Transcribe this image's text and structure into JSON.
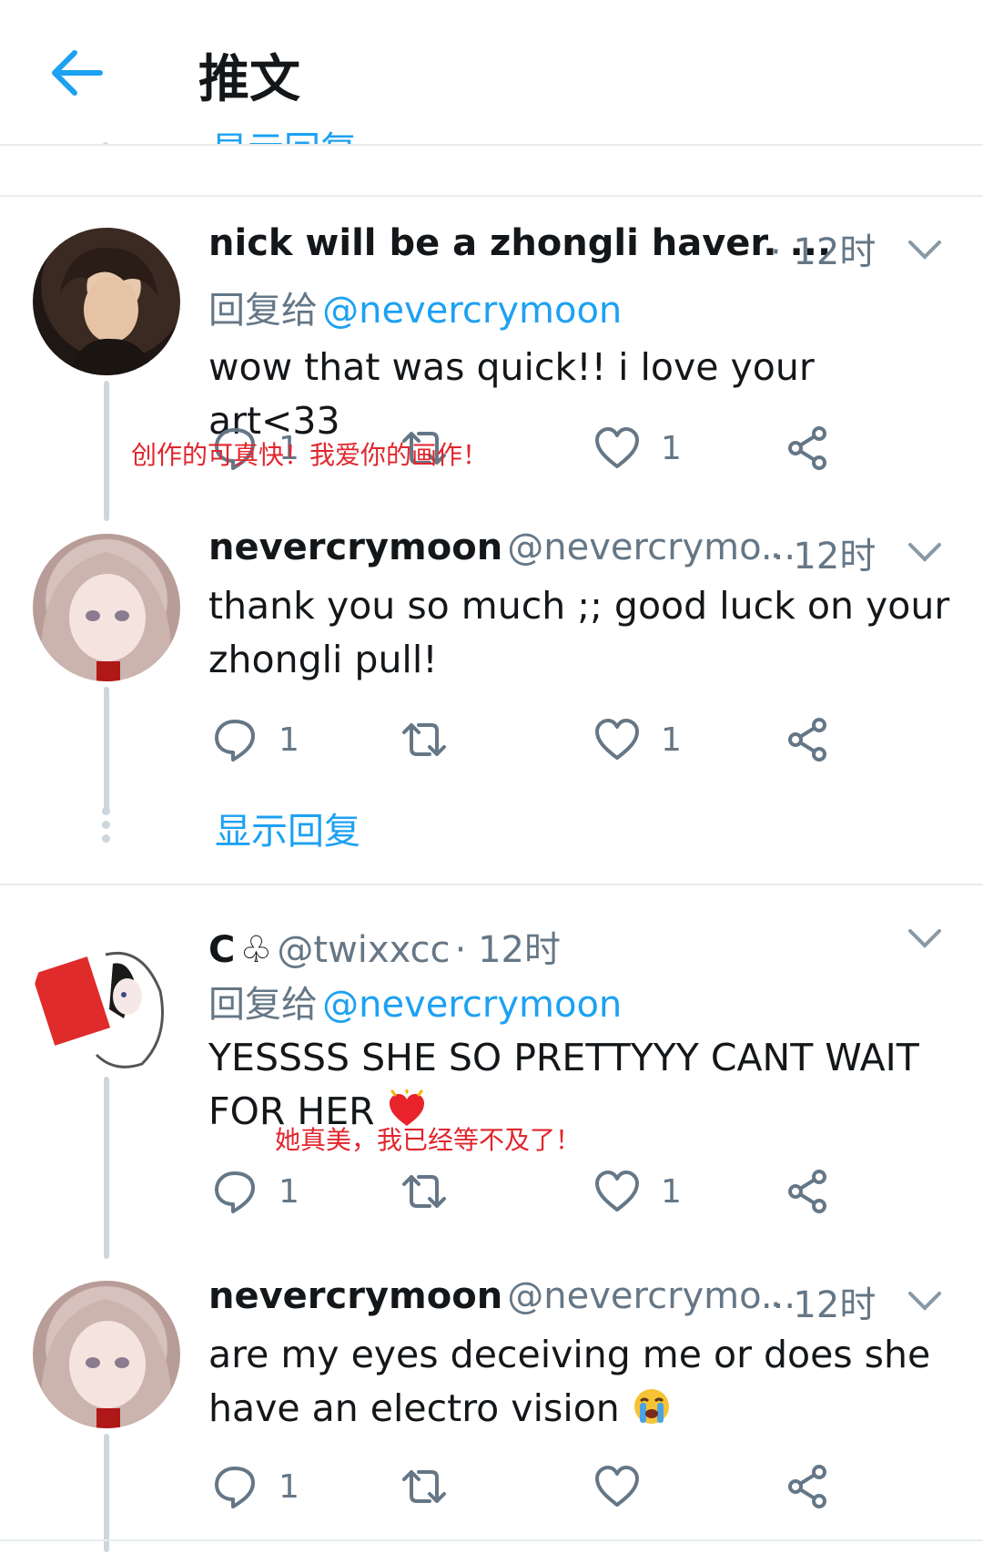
{
  "header": {
    "back_icon": "arrow-left-icon",
    "title": "推文",
    "clipped_show_replies": "显示回复"
  },
  "colors": {
    "accent": "#1da1f2",
    "secondary_text": "#657786",
    "annotation": "#e0262d",
    "thread_line": "#ccd6dd"
  },
  "tweets": [
    {
      "display_name": "nick will be a zhongli haver. ...",
      "handle": "",
      "time": "· 12时",
      "reply_label": "回复给",
      "reply_to": "@nevercrymoon",
      "text": "wow that was quick!! i love your art<33",
      "reply_count": "1",
      "retweet_count": "",
      "like_count": "1",
      "annotation": "创作的可真快！我爱你的画作！"
    },
    {
      "display_name": "nevercrymoon",
      "handle": "@nevercrymo...",
      "time": "· 12时",
      "text_line1": "thank you so much ;; good luck on your",
      "text_line2": "zhongli pull!",
      "reply_count": "1",
      "retweet_count": "",
      "like_count": "1",
      "show_replies": "显示回复"
    },
    {
      "display_name": "C",
      "name_icon": "club-suit-icon",
      "handle": "@twixxcc",
      "time": "· 12时",
      "reply_label": "回复给",
      "reply_to": "@nevercrymoon",
      "text_line1": "YESSSS SHE SO PRETTYYY CANT WAIT",
      "text_line2": "FOR HER",
      "emoji": "sparkling-heart-icon",
      "reply_count": "1",
      "retweet_count": "",
      "like_count": "1",
      "annotation": "她真美，我已经等不及了！"
    },
    {
      "display_name": "nevercrymoon",
      "handle": "@nevercrymo...",
      "time": "· 12时",
      "text_line1": "are my eyes deceiving me or does she",
      "text_line2": "have an electro vision",
      "emoji": "loudly-crying-face-icon",
      "reply_count": "1",
      "retweet_count": "",
      "like_count": ""
    }
  ]
}
